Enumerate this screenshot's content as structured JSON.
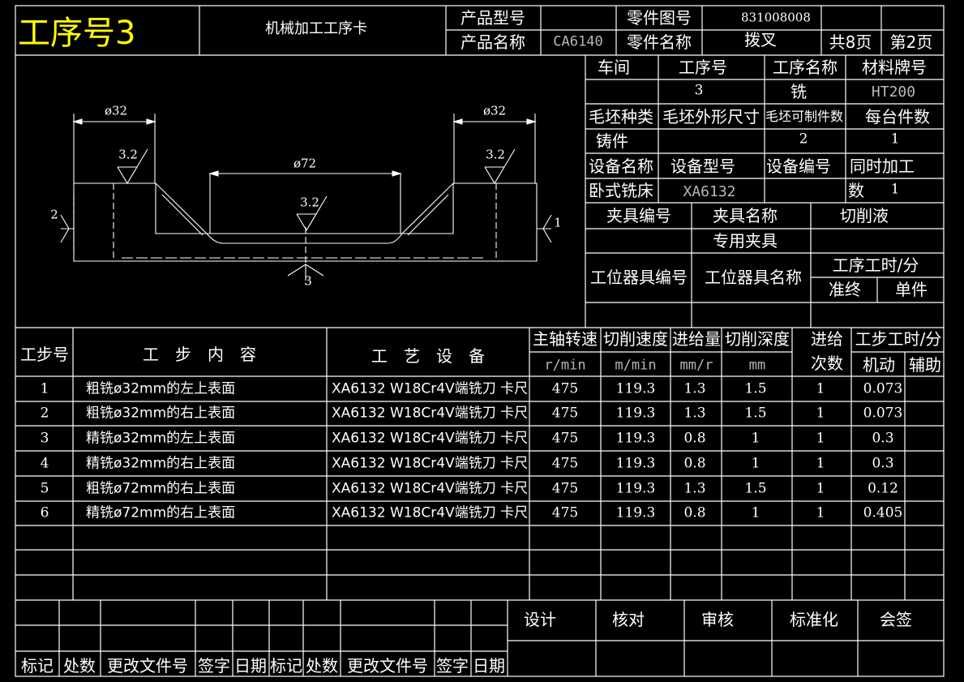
{
  "header": {
    "process_no": "工序号3",
    "card_title": "机械加工工序卡",
    "product_model_label": "产品型号",
    "product_model_value": "",
    "part_drawing_no_label": "零件图号",
    "part_drawing_no_value": "831008008",
    "product_name_label": "产品名称",
    "product_name_value": "CA6140",
    "part_name_label": "零件名称",
    "part_name_value": "拨叉",
    "total_pages": "共8页",
    "page_no": "第2页"
  },
  "info": {
    "workshop_label": "车间",
    "process_no_label": "工序号",
    "process_name_label": "工序名称",
    "material_label": "材料牌号",
    "workshop_value": "",
    "process_no_value": "3",
    "process_name_value": "铣",
    "material_value": "HT200",
    "blank_type_label": "毛坯种类",
    "blank_size_label": "毛坯外形尺寸",
    "blank_parts_label": "毛坯可制件数",
    "parts_per_unit_label": "每台件数",
    "blank_type_value": "铸件",
    "blank_size_value": "",
    "blank_parts_value": "2",
    "parts_per_unit_value": "1",
    "equip_name_label": "设备名称",
    "equip_model_label": "设备型号",
    "equip_no_label": "设备编号",
    "simul_label": "同时加工",
    "equip_name_value": "卧式铣床",
    "equip_model_value": "XA6132",
    "equip_no_value": "",
    "simul_count_label": "数",
    "simul_count_value": "1",
    "fixture_no_label": "夹具编号",
    "fixture_name_label": "夹具名称",
    "coolant_label": "切削液",
    "fixture_name_value": "专用夹具",
    "station_tool_no_label": "工位器具编号",
    "station_tool_name_label": "工位器具名称",
    "process_time_label": "工序工时/分",
    "prep_label": "准终",
    "unit_label": "单件"
  },
  "drawing": {
    "dim_left": "ø32",
    "dim_right": "ø32",
    "dim_center": "ø72",
    "rough_left": "3.2",
    "rough_center": "3.2",
    "rough_right": "3.2",
    "datum_left": "2",
    "datum_right": "1",
    "datum_bottom": "3"
  },
  "steps": {
    "headers": {
      "step_no": "工步号",
      "content": "工　步　内　容",
      "equipment": "工　艺　设　备",
      "spindle": "主轴转速",
      "speed": "切削速度",
      "feed": "进给量",
      "depth": "切削深度",
      "passes": "进给次数",
      "step_time": "工步工时/分",
      "machine": "机动",
      "aux": "辅助"
    },
    "units": {
      "spindle": "r/min",
      "speed": "m/min",
      "feed": "mm/r",
      "depth": "mm"
    },
    "rows": [
      {
        "no": "1",
        "content": "粗铣ø32mm的左上表面",
        "equip": "XA6132 W18Cr4V端铣刀 卡尺",
        "spindle": "475",
        "speed": "119.3",
        "feed": "1.3",
        "depth": "1.5",
        "passes": "1",
        "machine": "0.073",
        "aux": ""
      },
      {
        "no": "2",
        "content": "粗铣ø32mm的右上表面",
        "equip": "XA6132 W18Cr4V端铣刀 卡尺",
        "spindle": "475",
        "speed": "119.3",
        "feed": "1.3",
        "depth": "1.5",
        "passes": "1",
        "machine": "0.073",
        "aux": ""
      },
      {
        "no": "3",
        "content": "精铣ø32mm的左上表面",
        "equip": "XA6132 W18Cr4V端铣刀 卡尺",
        "spindle": "475",
        "speed": "119.3",
        "feed": "0.8",
        "depth": "1",
        "passes": "1",
        "machine": "0.3",
        "aux": ""
      },
      {
        "no": "4",
        "content": "精铣ø32mm的右上表面",
        "equip": "XA6132 W18Cr4V端铣刀 卡尺",
        "spindle": "475",
        "speed": "119.3",
        "feed": "0.8",
        "depth": "1",
        "passes": "1",
        "machine": "0.3",
        "aux": ""
      },
      {
        "no": "5",
        "content": "粗铣ø72mm的右上表面",
        "equip": "XA6132 W18Cr4V端铣刀 卡尺",
        "spindle": "475",
        "speed": "119.3",
        "feed": "1.3",
        "depth": "1.5",
        "passes": "1",
        "machine": "0.12",
        "aux": ""
      },
      {
        "no": "6",
        "content": "精铣ø72mm的右上表面",
        "equip": "XA6132 W18Cr4V端铣刀 卡尺",
        "spindle": "475",
        "speed": "119.3",
        "feed": "0.8",
        "depth": "1",
        "passes": "1",
        "machine": "0.405",
        "aux": ""
      }
    ]
  },
  "footer": {
    "design": "设计",
    "check": "核对",
    "review": "审核",
    "standard": "标准化",
    "countersign": "会签",
    "rev_labels": [
      "标记",
      "处数",
      "更改文件号",
      "签字",
      "日期",
      "标记",
      "处数",
      "更改文件号",
      "签字",
      "日期"
    ]
  },
  "colors": {
    "background": "#000000",
    "lines": "#ffffff",
    "title": "#ffff00",
    "value_gray": "#b8b8b8"
  }
}
